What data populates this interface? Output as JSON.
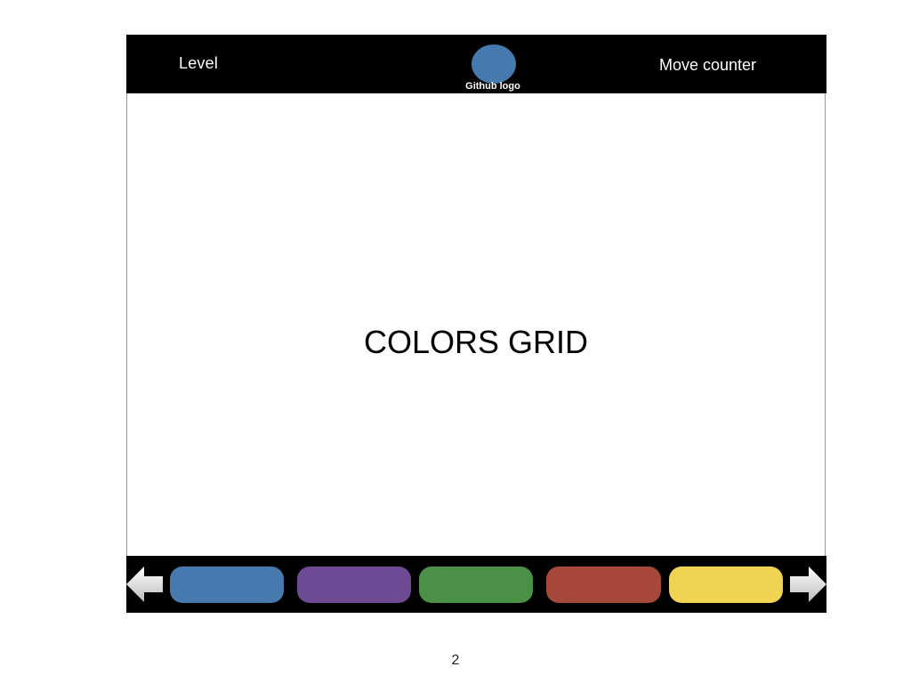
{
  "header": {
    "level_label": "Level",
    "logo_caption": "Github logo",
    "move_counter_label": "Move counter",
    "logo_color": "#4679ae"
  },
  "main": {
    "grid_title": "COLORS GRID"
  },
  "palette": {
    "left_arrow_icon": "arrow-left-icon",
    "right_arrow_icon": "arrow-right-icon",
    "swatches": [
      {
        "name": "blue",
        "color": "#4679ae"
      },
      {
        "name": "purple",
        "color": "#6e4a94"
      },
      {
        "name": "green",
        "color": "#4a9147"
      },
      {
        "name": "red",
        "color": "#a6493a"
      },
      {
        "name": "yellow",
        "color": "#f0d350"
      }
    ]
  },
  "page_number": "2"
}
